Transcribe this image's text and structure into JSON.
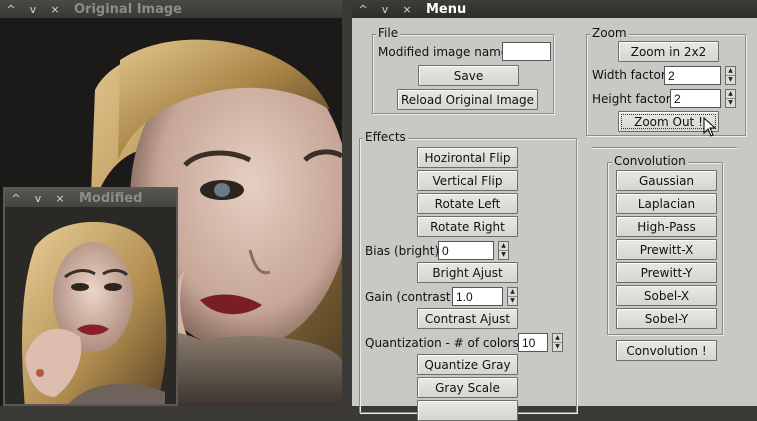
{
  "original_window": {
    "title": "Original Image",
    "controls": [
      "^",
      "v",
      "×"
    ]
  },
  "modified_window": {
    "title": "Modified",
    "controls": [
      "^",
      "v",
      "×"
    ]
  },
  "menu_window": {
    "title": "Menu",
    "controls": [
      "^",
      "v",
      "×"
    ]
  },
  "file": {
    "group_label": "File",
    "name_label": "Modified image name:",
    "name_value": "",
    "save": "Save",
    "reload": "Reload Original Image"
  },
  "zoom": {
    "group_label": "Zoom",
    "zoom_in": "Zoom in 2x2",
    "width_label": "Width factor:",
    "width_value": "2",
    "height_label": "Height factor:",
    "height_value": "2",
    "zoom_out": "Zoom Out !"
  },
  "effects": {
    "group_label": "Effects",
    "horizontal_flip": "Hozirontal Flip",
    "vertical_flip": "Vertical Flip",
    "rotate_left": "Rotate Left",
    "rotate_right": "Rotate Right",
    "bias_label": "Bias (bright):",
    "bias_value": "0",
    "bright_adjust": "Bright Ajust",
    "gain_label": "Gain (contrast):",
    "gain_value": "1.0",
    "contrast_adjust": "Contrast Ajust",
    "quant_label": "Quantization - # of colors:",
    "quant_value": "10",
    "quantize_gray": "Quantize Gray",
    "gray_scale": "Gray Scale"
  },
  "convolution": {
    "group_label": "Convolution",
    "gaussian": "Gaussian",
    "laplacian": "Laplacian",
    "high_pass": "High-Pass",
    "prewitt_x": "Prewitt-X",
    "prewitt_y": "Prewitt-Y",
    "sobel_x": "Sobel-X",
    "sobel_y": "Sobel-Y",
    "apply": "Convolution !"
  }
}
